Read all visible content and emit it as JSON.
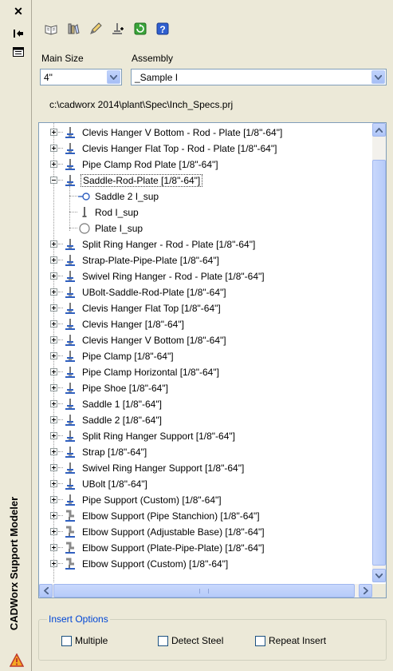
{
  "palette": {
    "title_blue": "#0046d5",
    "panel_bg": "#ece9d8",
    "border": "#7f9db9"
  },
  "side": {
    "title": "CADWorx Support Modeler",
    "buttons": [
      "close-icon",
      "auto-hide-icon",
      "properties-icon"
    ]
  },
  "toolbar": {
    "icons": [
      "open-book-icon",
      "library-icon",
      "edit-icon",
      "insert-support-icon",
      "refresh-icon",
      "help-icon"
    ]
  },
  "main_size": {
    "label": "Main Size",
    "value": "4\""
  },
  "assembly": {
    "label": "Assembly",
    "value": "_Sample I"
  },
  "spec_path": "c:\\cadworx 2014\\plant\\Spec\\Inch_Specs.prj",
  "tree": {
    "items": [
      {
        "label": "Clevis Hanger V Bottom - Rod - Plate [1/8\"-64\"]",
        "expanded": false,
        "icon": "hanger-icon"
      },
      {
        "label": "Clevis Hanger Flat Top - Rod - Plate [1/8\"-64\"]",
        "expanded": false,
        "icon": "hanger-icon"
      },
      {
        "label": "Pipe Clamp Rod Plate [1/8\"-64\"]",
        "expanded": false,
        "icon": "hanger-icon"
      },
      {
        "label": "Saddle-Rod-Plate [1/8\"-64\"]",
        "expanded": true,
        "selected": true,
        "icon": "hanger-icon",
        "children": [
          {
            "label": "Saddle 2 I_sup",
            "icon": "saddle-part-icon"
          },
          {
            "label": "Rod I_sup",
            "icon": "rod-part-icon"
          },
          {
            "label": "Plate I_sup",
            "icon": "plate-part-icon"
          }
        ]
      },
      {
        "label": "Split Ring Hanger - Rod - Plate [1/8\"-64\"]",
        "expanded": false,
        "icon": "hanger-icon"
      },
      {
        "label": "Strap-Plate-Pipe-Plate [1/8\"-64\"]",
        "expanded": false,
        "icon": "hanger-icon"
      },
      {
        "label": "Swivel Ring Hanger - Rod - Plate [1/8\"-64\"]",
        "expanded": false,
        "icon": "hanger-icon"
      },
      {
        "label": "UBolt-Saddle-Rod-Plate [1/8\"-64\"]",
        "expanded": false,
        "icon": "hanger-icon"
      },
      {
        "label": "Clevis Hanger Flat Top [1/8\"-64\"]",
        "expanded": false,
        "icon": "hanger-icon"
      },
      {
        "label": "Clevis Hanger [1/8\"-64\"]",
        "expanded": false,
        "icon": "hanger-icon"
      },
      {
        "label": "Clevis Hanger V Bottom [1/8\"-64\"]",
        "expanded": false,
        "icon": "hanger-icon"
      },
      {
        "label": "Pipe Clamp [1/8\"-64\"]",
        "expanded": false,
        "icon": "hanger-icon"
      },
      {
        "label": "Pipe Clamp Horizontal [1/8\"-64\"]",
        "expanded": false,
        "icon": "hanger-icon"
      },
      {
        "label": "Pipe Shoe [1/8\"-64\"]",
        "expanded": false,
        "icon": "hanger-icon"
      },
      {
        "label": "Saddle 1 [1/8\"-64\"]",
        "expanded": false,
        "icon": "hanger-icon"
      },
      {
        "label": "Saddle 2 [1/8\"-64\"]",
        "expanded": false,
        "icon": "hanger-icon"
      },
      {
        "label": "Split Ring Hanger Support [1/8\"-64\"]",
        "expanded": false,
        "icon": "hanger-icon"
      },
      {
        "label": "Strap [1/8\"-64\"]",
        "expanded": false,
        "icon": "hanger-icon"
      },
      {
        "label": "Swivel Ring Hanger Support [1/8\"-64\"]",
        "expanded": false,
        "icon": "hanger-icon"
      },
      {
        "label": "UBolt [1/8\"-64\"]",
        "expanded": false,
        "icon": "hanger-icon"
      },
      {
        "label": "Pipe Support (Custom) [1/8\"-64\"]",
        "expanded": false,
        "icon": "hanger-icon"
      },
      {
        "label": "Elbow Support (Pipe Stanchion) [1/8\"-64\"]",
        "expanded": false,
        "icon": "elbow-support-icon"
      },
      {
        "label": "Elbow Support (Adjustable Base) [1/8\"-64\"]",
        "expanded": false,
        "icon": "elbow-support-icon"
      },
      {
        "label": "Elbow Support (Plate-Pipe-Plate) [1/8\"-64\"]",
        "expanded": false,
        "icon": "elbow-support-icon"
      },
      {
        "label": "Elbow Support (Custom) [1/8\"-64\"]",
        "expanded": false,
        "icon": "elbow-support-icon"
      }
    ]
  },
  "insert_options": {
    "title": "Insert Options",
    "checkboxes": [
      {
        "label": "Multiple",
        "checked": false
      },
      {
        "label": "Detect Steel",
        "checked": false
      },
      {
        "label": "Repeat Insert",
        "checked": false
      }
    ]
  }
}
